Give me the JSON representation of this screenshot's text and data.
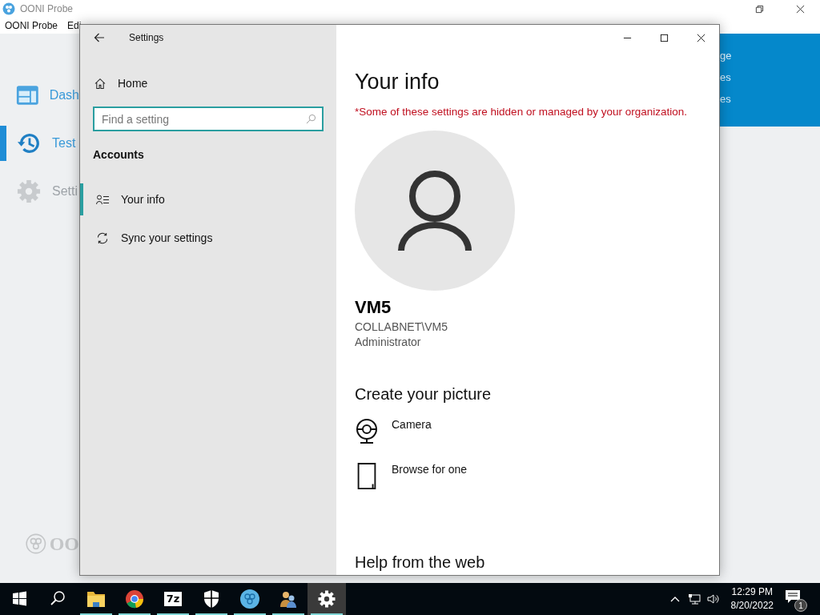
{
  "background_app": {
    "title": "OONI Probe",
    "menu": [
      "OONI Probe",
      "Edi"
    ],
    "nav": [
      {
        "label": "Dash",
        "kind": "dashboard",
        "selected": false
      },
      {
        "label": "Test",
        "kind": "history",
        "selected": true
      },
      {
        "label": "Setti",
        "kind": "settings",
        "selected": false
      }
    ],
    "banner_lines": [
      "ge",
      "es",
      "es"
    ],
    "logo_text": "OO"
  },
  "settings": {
    "title": "Settings",
    "home": "Home",
    "search": {
      "placeholder": "Find a setting"
    },
    "section": "Accounts",
    "items": [
      {
        "label": "Your info",
        "kind": "info",
        "selected": true
      },
      {
        "label": "Sync your settings",
        "kind": "sync",
        "selected": false
      }
    ],
    "heading": "Your info",
    "notice": "*Some of these settings are hidden or managed by your organization.",
    "user": {
      "name": "VM5",
      "account": "COLLABNET\\VM5",
      "role": "Administrator"
    },
    "picture_heading": "Create your picture",
    "options": [
      {
        "label": "Camera",
        "kind": "camera"
      },
      {
        "label": "Browse for one",
        "kind": "browse"
      }
    ],
    "help_heading": "Help from the web"
  },
  "taskbar": {
    "apps": [
      {
        "kind": "explorer",
        "running": true,
        "active": false
      },
      {
        "kind": "chrome",
        "running": true,
        "active": false
      },
      {
        "kind": "archiver",
        "label": "7z",
        "running": true,
        "active": false
      },
      {
        "kind": "shield",
        "running": true,
        "active": false
      },
      {
        "kind": "probe",
        "running": true,
        "active": false
      },
      {
        "kind": "users",
        "running": true,
        "active": false
      },
      {
        "kind": "gear",
        "running": true,
        "active": true
      }
    ],
    "time": "12:29 PM",
    "date": "8/20/2022",
    "notifications": "1"
  }
}
